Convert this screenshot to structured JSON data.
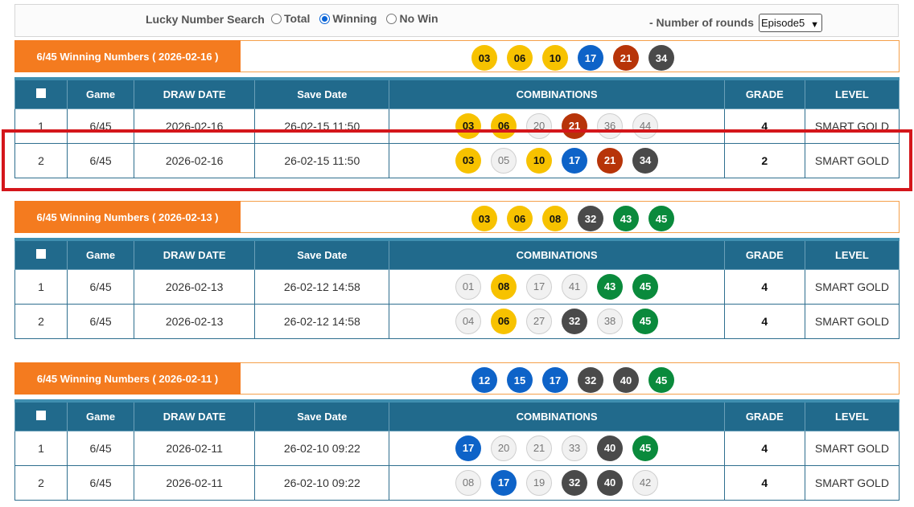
{
  "search": {
    "label": "Lucky Number Search",
    "options": [
      "Total",
      "Winning",
      "No Win"
    ],
    "selected": "Winning",
    "rounds_label": "- Number of rounds",
    "rounds_value": "Episode5"
  },
  "table_headers": [
    "Game",
    "DRAW DATE",
    "Save Date",
    "COMBINATIONS",
    "GRADE",
    "LEVEL"
  ],
  "colors": {
    "accent": "#f47b1f",
    "header": "#216a8c",
    "highlight": "#d4161b"
  },
  "sections": [
    {
      "title": "6/45 Winning Numbers ( 2026-02-16 )",
      "winning": [
        {
          "n": "03",
          "c": "yellow"
        },
        {
          "n": "06",
          "c": "yellow"
        },
        {
          "n": "10",
          "c": "yellow"
        },
        {
          "n": "17",
          "c": "blue"
        },
        {
          "n": "21",
          "c": "red"
        },
        {
          "n": "34",
          "c": "dark"
        }
      ],
      "rows": [
        {
          "no": "1",
          "game": "6/45",
          "draw_date": "2026-02-16",
          "save_date": "26-02-15 11:50",
          "combo": [
            {
              "n": "03",
              "c": "yellow"
            },
            {
              "n": "06",
              "c": "yellow"
            },
            {
              "n": "20",
              "c": "gray"
            },
            {
              "n": "21",
              "c": "red"
            },
            {
              "n": "36",
              "c": "gray"
            },
            {
              "n": "44",
              "c": "gray"
            }
          ],
          "grade": "4",
          "level": "SMART GOLD"
        },
        {
          "no": "2",
          "game": "6/45",
          "draw_date": "2026-02-16",
          "save_date": "26-02-15 11:50",
          "combo": [
            {
              "n": "03",
              "c": "yellow"
            },
            {
              "n": "05",
              "c": "gray"
            },
            {
              "n": "10",
              "c": "yellow"
            },
            {
              "n": "17",
              "c": "blue"
            },
            {
              "n": "21",
              "c": "red"
            },
            {
              "n": "34",
              "c": "dark"
            }
          ],
          "grade": "2",
          "level": "SMART GOLD"
        }
      ]
    },
    {
      "title": "6/45 Winning Numbers ( 2026-02-13 )",
      "winning": [
        {
          "n": "03",
          "c": "yellow"
        },
        {
          "n": "06",
          "c": "yellow"
        },
        {
          "n": "08",
          "c": "yellow"
        },
        {
          "n": "32",
          "c": "dark"
        },
        {
          "n": "43",
          "c": "green"
        },
        {
          "n": "45",
          "c": "green"
        }
      ],
      "rows": [
        {
          "no": "1",
          "game": "6/45",
          "draw_date": "2026-02-13",
          "save_date": "26-02-12 14:58",
          "combo": [
            {
              "n": "01",
              "c": "gray"
            },
            {
              "n": "08",
              "c": "yellow"
            },
            {
              "n": "17",
              "c": "gray"
            },
            {
              "n": "41",
              "c": "gray"
            },
            {
              "n": "43",
              "c": "green"
            },
            {
              "n": "45",
              "c": "green"
            }
          ],
          "grade": "4",
          "level": "SMART GOLD"
        },
        {
          "no": "2",
          "game": "6/45",
          "draw_date": "2026-02-13",
          "save_date": "26-02-12 14:58",
          "combo": [
            {
              "n": "04",
              "c": "gray"
            },
            {
              "n": "06",
              "c": "yellow"
            },
            {
              "n": "27",
              "c": "gray"
            },
            {
              "n": "32",
              "c": "dark"
            },
            {
              "n": "38",
              "c": "gray"
            },
            {
              "n": "45",
              "c": "green"
            }
          ],
          "grade": "4",
          "level": "SMART GOLD"
        }
      ]
    },
    {
      "title": "6/45 Winning Numbers ( 2026-02-11 )",
      "winning": [
        {
          "n": "12",
          "c": "blue"
        },
        {
          "n": "15",
          "c": "blue"
        },
        {
          "n": "17",
          "c": "blue"
        },
        {
          "n": "32",
          "c": "dark"
        },
        {
          "n": "40",
          "c": "dark"
        },
        {
          "n": "45",
          "c": "green"
        }
      ],
      "rows": [
        {
          "no": "1",
          "game": "6/45",
          "draw_date": "2026-02-11",
          "save_date": "26-02-10 09:22",
          "combo": [
            {
              "n": "17",
              "c": "blue"
            },
            {
              "n": "20",
              "c": "gray"
            },
            {
              "n": "21",
              "c": "gray"
            },
            {
              "n": "33",
              "c": "gray"
            },
            {
              "n": "40",
              "c": "dark"
            },
            {
              "n": "45",
              "c": "green"
            }
          ],
          "grade": "4",
          "level": "SMART GOLD"
        },
        {
          "no": "2",
          "game": "6/45",
          "draw_date": "2026-02-11",
          "save_date": "26-02-10 09:22",
          "combo": [
            {
              "n": "08",
              "c": "gray"
            },
            {
              "n": "17",
              "c": "blue"
            },
            {
              "n": "19",
              "c": "gray"
            },
            {
              "n": "32",
              "c": "dark"
            },
            {
              "n": "40",
              "c": "dark"
            },
            {
              "n": "42",
              "c": "gray"
            }
          ],
          "grade": "4",
          "level": "SMART GOLD"
        }
      ]
    }
  ]
}
